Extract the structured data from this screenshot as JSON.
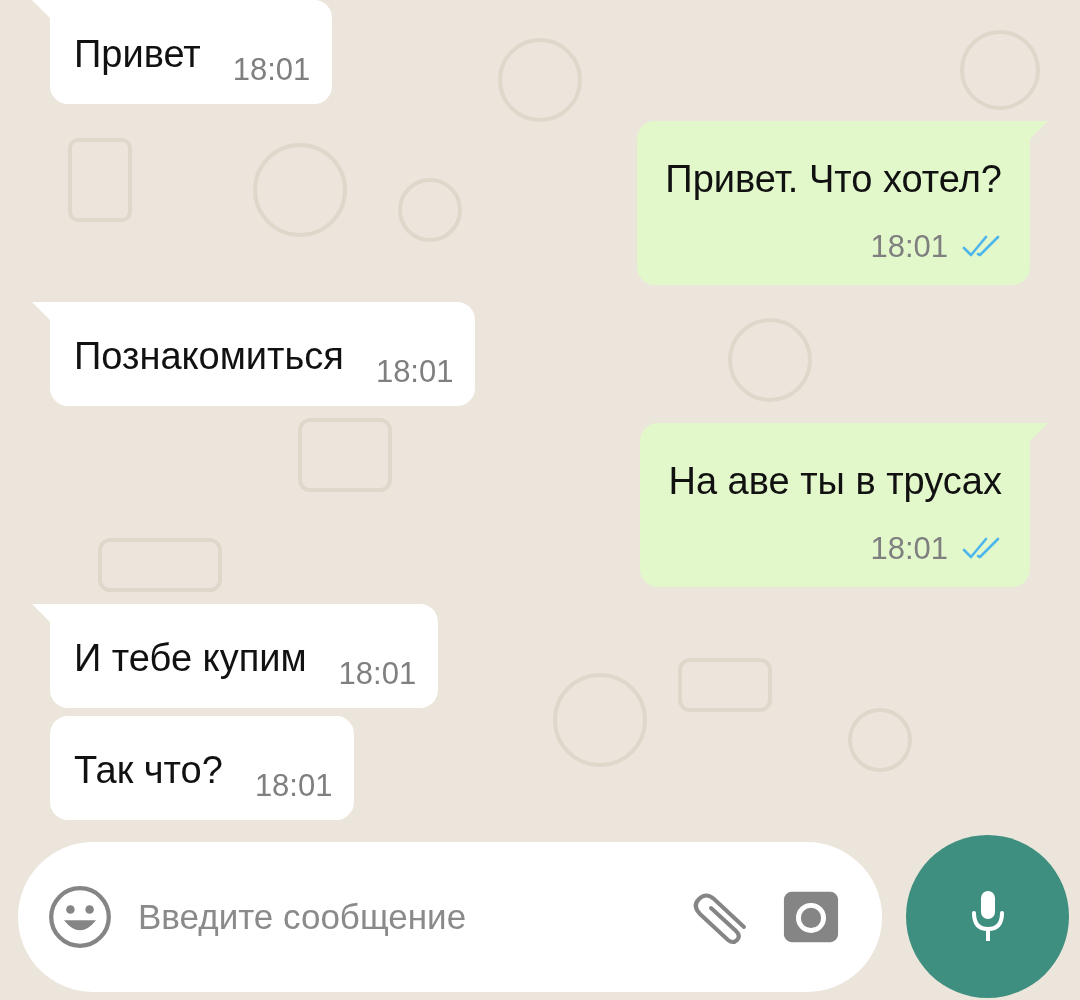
{
  "messages": [
    {
      "kind": "incoming",
      "text": "Привет",
      "time": "18:01",
      "tail": true
    },
    {
      "kind": "outgoing",
      "text": "Привет. Что хотел?",
      "time": "18:01",
      "tail": true,
      "read": true
    },
    {
      "kind": "incoming",
      "text": "Познакомиться",
      "time": "18:01",
      "tail": true
    },
    {
      "kind": "outgoing",
      "text": "На аве ты в трусах",
      "time": "18:01",
      "tail": true,
      "read": true
    },
    {
      "kind": "incoming",
      "text": "И тебе купим",
      "time": "18:01",
      "tail": true
    },
    {
      "kind": "incoming",
      "text": "Так что?",
      "time": "18:01",
      "tail": false
    }
  ],
  "composer": {
    "placeholder": "Введите сообщение"
  }
}
